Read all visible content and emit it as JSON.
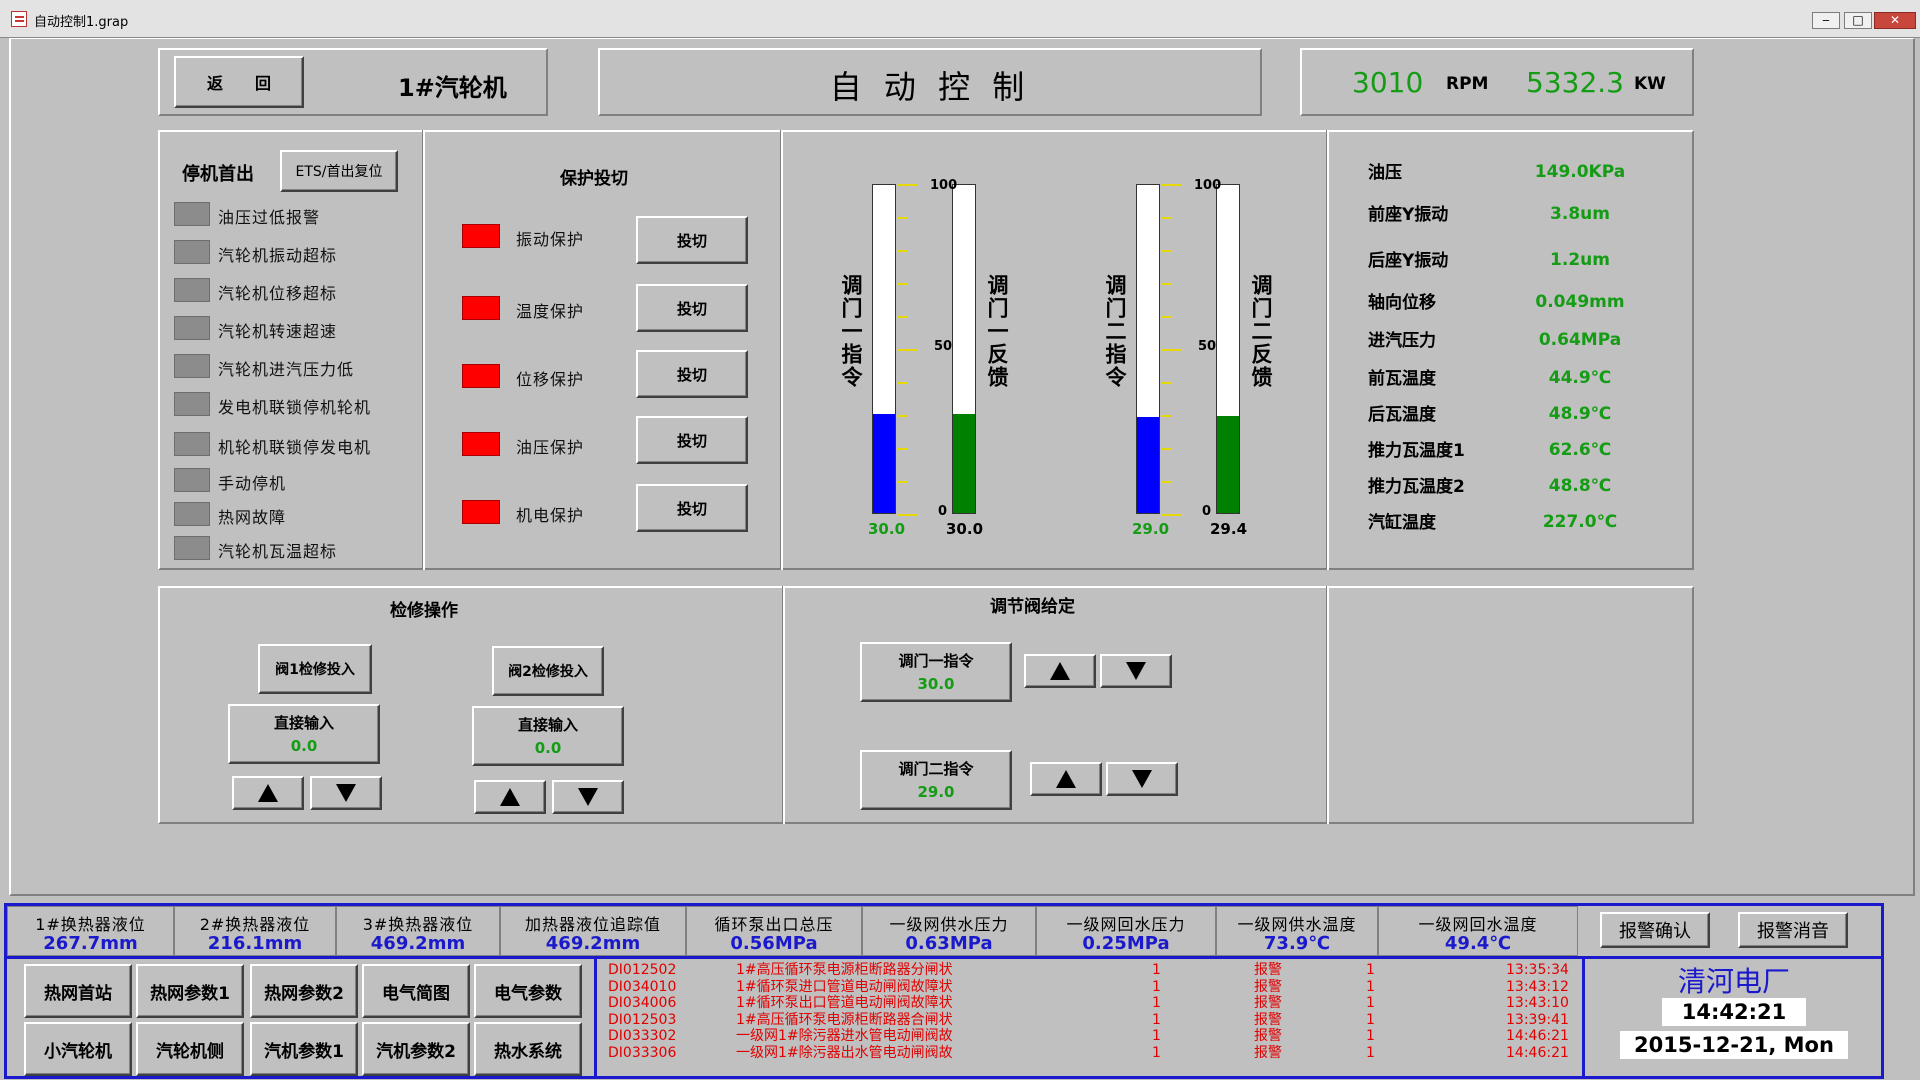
{
  "window": {
    "title": "自动控制1.grap",
    "min": "‒",
    "max": "□",
    "close": "✕"
  },
  "header": {
    "back_label": "返　　回",
    "unit_name": "1#汽轮机",
    "page_title": "自 动 控 制",
    "speed_value": "3010",
    "speed_unit": "RPM",
    "power_value": "5332.3",
    "power_unit": "KW"
  },
  "trip": {
    "title": "停机首出",
    "reset_label": "ETS/首出复位",
    "items": [
      "油压过低报警",
      "汽轮机振动超标",
      "汽轮机位移超标",
      "汽轮机转速超速",
      "汽轮机进汽压力低",
      "发电机联锁停机轮机",
      "机轮机联锁停发电机",
      "手动停机",
      "热网故障",
      "汽轮机瓦温超标"
    ]
  },
  "protect": {
    "title": "保护投切",
    "items": [
      {
        "label": "振动保护",
        "btn": "投切"
      },
      {
        "label": "温度保护",
        "btn": "投切"
      },
      {
        "label": "位移保护",
        "btn": "投切"
      },
      {
        "label": "油压保护",
        "btn": "投切"
      },
      {
        "label": "机电保护",
        "btn": "投切"
      }
    ]
  },
  "gauges": {
    "g1": {
      "cmd_label": "调门一指令",
      "fb_label": "调门一反馈",
      "cmd_value": "30.0",
      "fb_value": "30.0",
      "cmd_level": 30.0,
      "fb_level": 30.0
    },
    "g2": {
      "cmd_label": "调门二指令",
      "fb_label": "调门二反馈",
      "cmd_value": "29.0",
      "fb_value": "29.4",
      "cmd_level": 29.0,
      "fb_level": 29.4
    },
    "scale": {
      "max": "100",
      "mid": "50",
      "min": "0"
    },
    "cmd_color": "#0000ff",
    "fb_color": "#008000"
  },
  "params": [
    {
      "label": "油压",
      "value": "149.0KPa"
    },
    {
      "label": "前座Y振动",
      "value": "3.8um"
    },
    {
      "label": "后座Y振动",
      "value": "1.2um"
    },
    {
      "label": "轴向位移",
      "value": "0.049mm"
    },
    {
      "label": "进汽压力",
      "value": "0.64MPa"
    },
    {
      "label": "前瓦温度",
      "value": "44.9℃"
    },
    {
      "label": "后瓦温度",
      "value": "48.9℃"
    },
    {
      "label": "推力瓦温度1",
      "value": "62.6℃"
    },
    {
      "label": "推力瓦温度2",
      "value": "48.8℃"
    },
    {
      "label": "汽缸温度",
      "value": "227.0℃"
    }
  ],
  "maintenance": {
    "title": "检修操作",
    "valve1_btn": "阀1检修投入",
    "valve2_btn": "阀2检修投入",
    "input1_label": "直接输入",
    "input1_value": "0.0",
    "input2_label": "直接输入",
    "input2_value": "0.0"
  },
  "regulate": {
    "title": "调节阀给定",
    "v1_label": "调门一指令",
    "v1_value": "30.0",
    "v2_label": "调门二指令",
    "v2_value": "29.0"
  },
  "bottom_values": [
    {
      "label": "1#换热器液位",
      "value": "267.7mm"
    },
    {
      "label": "2#换热器液位",
      "value": "216.1mm"
    },
    {
      "label": "3#换热器液位",
      "value": "469.2mm"
    },
    {
      "label": "加热器液位追踪值",
      "value": "469.2mm"
    },
    {
      "label": "循环泵出口总压",
      "value": "0.56MPa"
    },
    {
      "label": "一级网供水压力",
      "value": "0.63MPa"
    },
    {
      "label": "一级网回水压力",
      "value": "0.25MPa"
    },
    {
      "label": "一级网供水温度",
      "value": "73.9℃"
    },
    {
      "label": "一级网回水温度",
      "value": "49.4℃"
    }
  ],
  "alarm_buttons": {
    "ack": "报警确认",
    "mute": "报警消音"
  },
  "nav": [
    "热网首站",
    "热网参数1",
    "热网参数2",
    "电气简图",
    "电气参数",
    "小汽轮机",
    "汽轮机侧",
    "汽机参数1",
    "汽机参数2",
    "热水系统"
  ],
  "alarms": [
    {
      "code": "DI012502",
      "desc": "1#高压循环泵电源柜断路器分闸状",
      "n": "1",
      "state": "报警",
      "f": "1",
      "time": "13:35:34"
    },
    {
      "code": "DI034010",
      "desc": "1#循环泵进口管道电动闸阀故障状",
      "n": "1",
      "state": "报警",
      "f": "1",
      "time": "13:43:12"
    },
    {
      "code": "DI034006",
      "desc": "1#循环泵出口管道电动闸阀故障状",
      "n": "1",
      "state": "报警",
      "f": "1",
      "time": "13:43:10"
    },
    {
      "code": "DI012503",
      "desc": "1#高压循环泵电源柜断路器合闸状",
      "n": "1",
      "state": "报警",
      "f": "1",
      "time": "13:39:41"
    },
    {
      "code": "DI033302",
      "desc": "一级网1#除污器进水管电动闸阀故",
      "n": "1",
      "state": "报警",
      "f": "1",
      "time": "14:46:21"
    },
    {
      "code": "DI033306",
      "desc": "一级网1#除污器出水管电动闸阀故",
      "n": "1",
      "state": "报警",
      "f": "1",
      "time": "14:46:21"
    }
  ],
  "plant": {
    "name": "清河电厂",
    "time": "14:42:21",
    "date": "2015-12-21, Mon"
  }
}
